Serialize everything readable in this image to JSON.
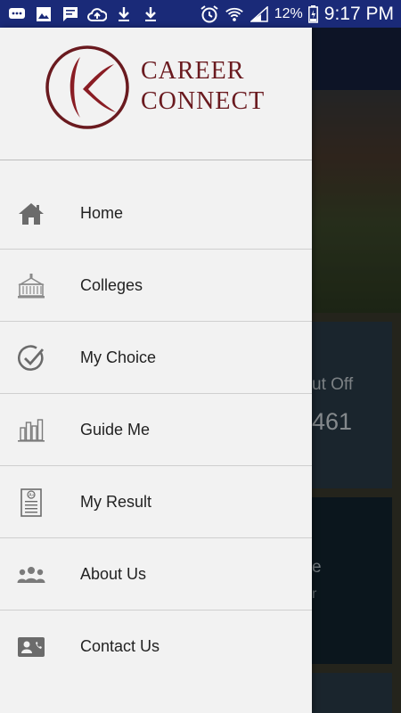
{
  "status_bar": {
    "battery_percent": "12%",
    "time": "9:17 PM",
    "left_icons": [
      "chat-icon",
      "image-icon",
      "message-icon",
      "cloud-upload-icon",
      "download-icon",
      "download-icon"
    ],
    "right_icons": [
      "alarm-icon",
      "wifi-icon",
      "signal-icon",
      "battery-icon"
    ]
  },
  "logo": {
    "line1": "CAREER",
    "line2": "CONNECT",
    "brand_color": "#6a1a1f"
  },
  "menu": {
    "items": [
      {
        "label": "Home",
        "icon": "home-icon"
      },
      {
        "label": "Colleges",
        "icon": "college-building-icon"
      },
      {
        "label": "My Choice",
        "icon": "check-circle-icon"
      },
      {
        "label": "Guide Me",
        "icon": "bar-chart-icon"
      },
      {
        "label": "My Result",
        "icon": "result-document-icon"
      },
      {
        "label": "About Us",
        "icon": "group-icon"
      },
      {
        "label": "Contact Us",
        "icon": "contact-card-icon"
      }
    ]
  },
  "background": {
    "card1_text": "ut Off",
    "card1_number": "461",
    "card2_text": "e",
    "card2_sub": "r"
  }
}
